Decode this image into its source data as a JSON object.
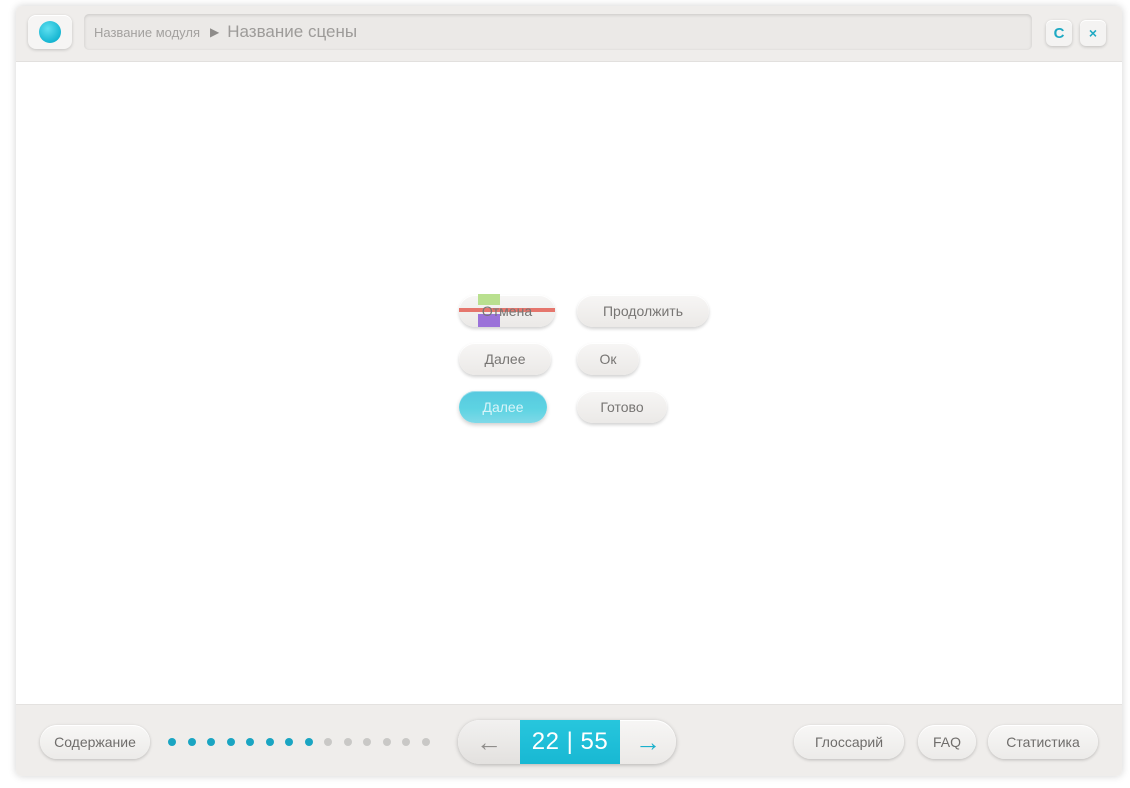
{
  "header": {
    "module_name": "Название модуля",
    "separator": "▶",
    "scene_name": "Название сцены",
    "reload_icon": "C",
    "close_icon": "×"
  },
  "buttons": {
    "cancel": "Отмена",
    "continue": "Продолжить",
    "next": "Далее",
    "ok": "Ок",
    "next_active": "Далее",
    "done": "Готово"
  },
  "footer": {
    "contents": "Содержание",
    "progress": {
      "completed": 8,
      "total": 14
    },
    "pager": {
      "prev_icon": "←",
      "count": "22 | 55",
      "next_icon": "→"
    },
    "glossary": "Глоссарий",
    "faq": "FAQ",
    "stats": "Статистика"
  },
  "colors": {
    "accent": "#1ab0cc",
    "header_bg": "#efedeb",
    "dot_active": "#1aa5c2",
    "dot_inactive": "#c9c8c6"
  }
}
